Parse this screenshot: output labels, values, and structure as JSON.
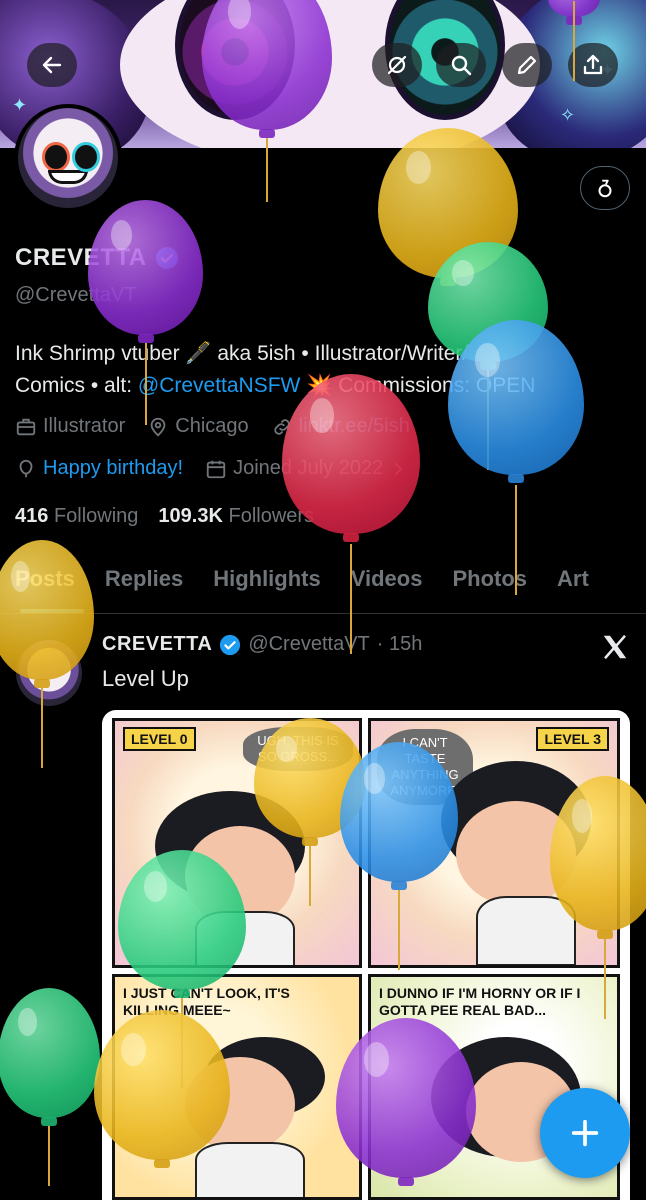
{
  "profile": {
    "name": "CREVETTA",
    "handle": "@CrevettaVT",
    "bio_part1": "Ink Shrimp vtuber 🖋️ aka 5ish • Illustrator/Writer/",
    "bio_part2": "Comics • alt: ",
    "bio_alt_link": "@CrevettaNSFW",
    "bio_part3": " 💥 Commissions: OPEN",
    "category": "Illustrator",
    "location": "Chicago",
    "website": "linktr.ee/5ish",
    "birthday": "Happy birthday!",
    "joined": "Joined July 2022",
    "following_count": "416",
    "following_label": "Following",
    "followers_count": "109.3K",
    "followers_label": "Followers"
  },
  "tabs": [
    "Posts",
    "Replies",
    "Highlights",
    "Videos",
    "Photos",
    "Art"
  ],
  "post": {
    "author": "CREVETTA",
    "handle": "@CrevettaVT",
    "time": "· 15h",
    "text": "Level Up",
    "comic": {
      "level_left": "LEVEL 0",
      "level_right": "LEVEL 3",
      "bubble1": "UGH, THIS IS SO GROSS...",
      "bubble2": "I CAN'T TASTE ANYTHING ANYMORE!",
      "text3": "I JUST CAN'T LOOK, IT'S KILLING MEEE~",
      "text4": "I DUNNO IF I'M HORNY OR IF I GOTTA PEE REAL BAD..."
    }
  },
  "icons": {
    "back": "arrow-left-icon",
    "hide": "eye-off-icon",
    "search": "search-icon",
    "edit": "pencil-icon",
    "share": "share-icon",
    "subscribe": "ring-bag-icon",
    "compose": "plus-icon"
  },
  "colors": {
    "accent": "#1d9bf0",
    "background": "#000000",
    "text": "#e7e9ea",
    "muted": "#71767b"
  }
}
